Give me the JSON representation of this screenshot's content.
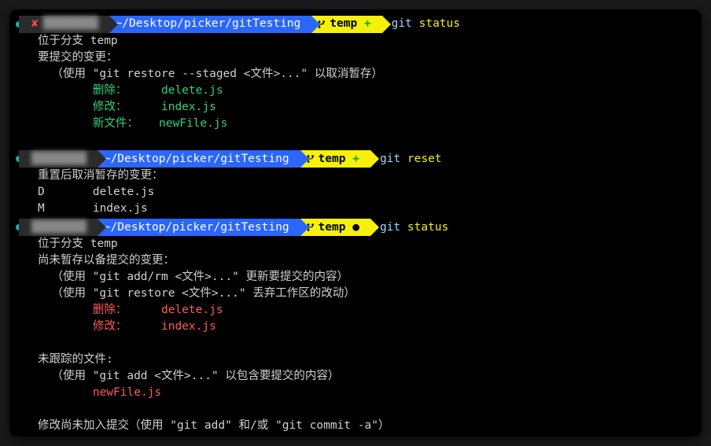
{
  "colors": {
    "blue": "#2a66ff",
    "yellow": "#f5f10a",
    "green": "#33d17a",
    "red": "#ff5b5b"
  },
  "prompts": [
    {
      "showX": true,
      "host": "████████",
      "path": "~/Desktop/picker/gitTesting",
      "branch": "temp",
      "branchSuffixType": "plus",
      "branchSuffix": "+",
      "cmd_git": "git",
      "cmd_arg": "status"
    },
    {
      "showX": false,
      "host": "████████",
      "path": "~/Desktop/picker/gitTesting",
      "branch": "temp",
      "branchSuffixType": "plus",
      "branchSuffix": "+",
      "cmd_git": "git",
      "cmd_arg": "reset"
    },
    {
      "showX": false,
      "host": "████████",
      "path": "~/Desktop/picker/gitTesting",
      "branch": "temp",
      "branchSuffixType": "dot",
      "branchSuffix": "●",
      "cmd_git": "git",
      "cmd_arg": "status"
    }
  ],
  "block1": {
    "l1": "位于分支 temp",
    "l2": "要提交的变更：",
    "l3": "  （使用 \"git restore --staged <文件>...\" 以取消暂存）",
    "l4a": "        删除：",
    "l4b": "     delete.js",
    "l5a": "        修改：",
    "l5b": "     index.js",
    "l6a": "        新文件：",
    "l6b": "   newFile.js"
  },
  "block2": {
    "l1": "重置后取消暂存的变更：",
    "l2": "D       delete.js",
    "l3": "M       index.js"
  },
  "block3": {
    "l1": "位于分支 temp",
    "l2": "尚未暂存以备提交的变更：",
    "l3": "  （使用 \"git add/rm <文件>...\" 更新要提交的内容）",
    "l4": "  （使用 \"git restore <文件>...\" 丢弃工作区的改动）",
    "l5a": "        删除：",
    "l5b": "     delete.js",
    "l6a": "        修改：",
    "l6b": "     index.js",
    "l7": "",
    "l8": "未跟踪的文件:",
    "l9": "  （使用 \"git add <文件>...\" 以包含要提交的内容）",
    "l10": "        newFile.js",
    "l11": "",
    "l12": "修改尚未加入提交（使用 \"git add\" 和/或 \"git commit -a\"）"
  }
}
